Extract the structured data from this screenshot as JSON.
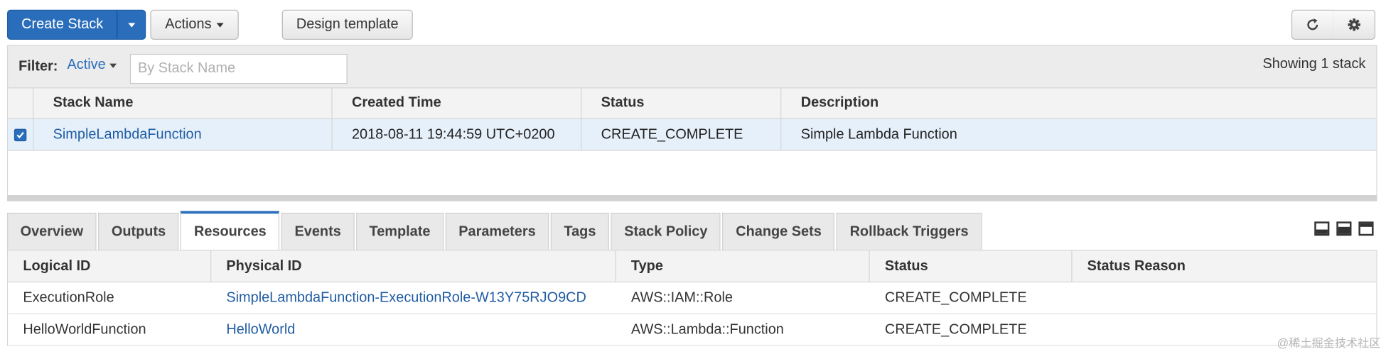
{
  "toolbar": {
    "create_stack": "Create Stack",
    "actions": "Actions",
    "design_template": "Design template",
    "refresh_icon": "refresh-icon",
    "settings_icon": "gear-icon"
  },
  "filter": {
    "label": "Filter:",
    "active": "Active",
    "placeholder": "By Stack Name",
    "showing": "Showing 1 stack"
  },
  "stack_table": {
    "columns": [
      "Stack Name",
      "Created Time",
      "Status",
      "Description"
    ],
    "rows": [
      {
        "selected": true,
        "name": "SimpleLambdaFunction",
        "created": "2018-08-11 19:44:59 UTC+0200",
        "status": "CREATE_COMPLETE",
        "description": "Simple Lambda Function"
      }
    ]
  },
  "tabs": [
    "Overview",
    "Outputs",
    "Resources",
    "Events",
    "Template",
    "Parameters",
    "Tags",
    "Stack Policy",
    "Change Sets",
    "Rollback Triggers"
  ],
  "active_tab": "Resources",
  "resources": {
    "columns": [
      "Logical ID",
      "Physical ID",
      "Type",
      "Status",
      "Status Reason"
    ],
    "rows": [
      {
        "logical_id": "ExecutionRole",
        "physical_id": "SimpleLambdaFunction-ExecutionRole-W13Y75RJO9CD",
        "type": "AWS::IAM::Role",
        "status": "CREATE_COMPLETE",
        "reason": ""
      },
      {
        "logical_id": "HelloWorldFunction",
        "physical_id": "HelloWorld",
        "type": "AWS::Lambda::Function",
        "status": "CREATE_COMPLETE",
        "reason": ""
      }
    ]
  },
  "watermark": "@稀土掘金技术社区",
  "colors": {
    "accent": "#2a6ebb",
    "selected_row": "#e6f0fa"
  }
}
